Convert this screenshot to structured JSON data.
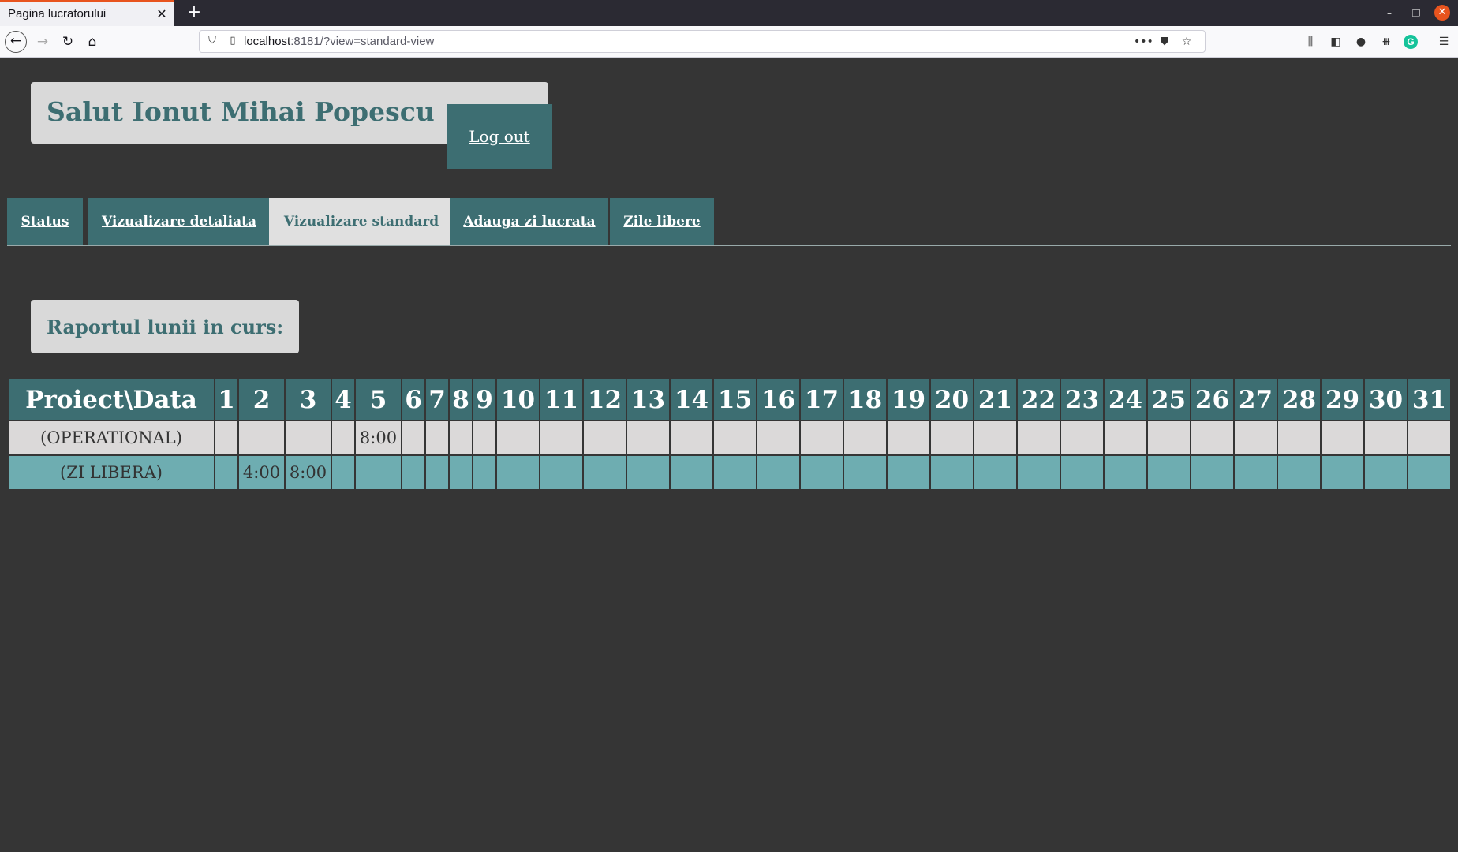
{
  "browser": {
    "tab_title": "Pagina lucratorului",
    "url_host": "localhost",
    "url_rest": ":8181/?view=standard-view"
  },
  "header": {
    "greeting": "Salut Ionut Mihai Popescu",
    "logout_label": "Log out"
  },
  "nav_tabs": [
    {
      "label": "Status",
      "active": false
    },
    {
      "label": "Vizualizare detaliata",
      "active": false
    },
    {
      "label": "Vizualizare standard",
      "active": true
    },
    {
      "label": "Adauga zi lucrata",
      "active": false
    },
    {
      "label": "Zile libere",
      "active": false
    }
  ],
  "report": {
    "title": "Raportul lunii in curs:",
    "header_label": "Proiect\\Data",
    "days": [
      "1",
      "2",
      "3",
      "4",
      "5",
      "6",
      "7",
      "8",
      "9",
      "10",
      "11",
      "12",
      "13",
      "14",
      "15",
      "16",
      "17",
      "18",
      "19",
      "20",
      "21",
      "22",
      "23",
      "24",
      "25",
      "26",
      "27",
      "28",
      "29",
      "30",
      "31"
    ],
    "rows": [
      {
        "project": "(OPERATIONAL)",
        "hours": [
          "",
          "",
          "",
          "",
          "8:00",
          "",
          "",
          "",
          "",
          "",
          "",
          "",
          "",
          "",
          "",
          "",
          "",
          "",
          "",
          "",
          "",
          "",
          "",
          "",
          "",
          "",
          "",
          "",
          "",
          "",
          ""
        ]
      },
      {
        "project": "(ZI LIBERA)",
        "hours": [
          "",
          "4:00",
          "8:00",
          "",
          "",
          "",
          "",
          "",
          "",
          "",
          "",
          "",
          "",
          "",
          "",
          "",
          "",
          "",
          "",
          "",
          "",
          "",
          "",
          "",
          "",
          "",
          "",
          "",
          "",
          "",
          ""
        ]
      }
    ]
  },
  "colors": {
    "background": "#353535",
    "accent": "#3d6e72",
    "light_panel": "#d9d9d9",
    "row_alt": "#6eadb1"
  }
}
